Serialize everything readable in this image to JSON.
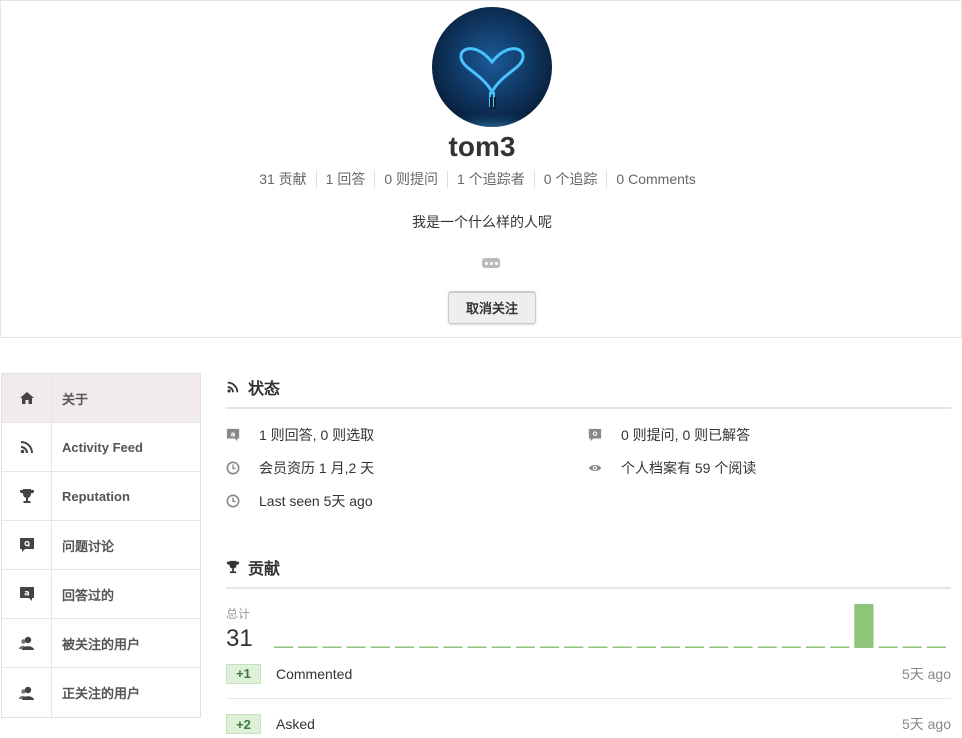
{
  "profile": {
    "username": "tom3",
    "stats": [
      "31 贡献",
      "1 回答",
      "0 则提问",
      "1 个追踪者",
      "0 个追踪",
      "0 Comments"
    ],
    "bio": "我是一个什么样的人呢",
    "unfollow_label": "取消关注",
    "colors": {
      "avatar_bg": "#0a2c55",
      "heart": "#2aa8ff"
    }
  },
  "sidebar": {
    "items": [
      {
        "label": "关于",
        "icon": "home-icon",
        "active": true
      },
      {
        "label": "Activity Feed",
        "icon": "rss-icon"
      },
      {
        "label": "Reputation",
        "icon": "trophy-icon"
      },
      {
        "label": "问题讨论",
        "icon": "question-bubble-icon"
      },
      {
        "label": "回答过的",
        "icon": "answer-bubble-icon"
      },
      {
        "label": "被关注的用户",
        "icon": "users-icon"
      },
      {
        "label": "正关注的用户",
        "icon": "users-icon"
      }
    ]
  },
  "status": {
    "title": "状态",
    "items": [
      {
        "text": "1 则回答, 0 则选取",
        "icon": "answer-bubble-icon"
      },
      {
        "text": "0 则提问, 0 则已解答",
        "icon": "question-bubble-icon"
      },
      {
        "text": "会员资历 1 月,2 天",
        "icon": "clock-icon"
      },
      {
        "text": "个人档案有 59 个阅读",
        "icon": "eye-icon"
      },
      {
        "text": "Last seen 5天 ago",
        "icon": "clock-icon"
      }
    ]
  },
  "contributions": {
    "title": "贡献",
    "total_label": "总计",
    "total_value": "31",
    "activities": [
      {
        "badge": "+1",
        "label": "Commented",
        "time": "5天 ago"
      },
      {
        "badge": "+2",
        "label": "Asked",
        "time": "5天 ago"
      }
    ]
  },
  "chart_data": {
    "type": "bar",
    "bar_count": 28,
    "values": [
      0,
      0,
      0,
      0,
      0,
      0,
      0,
      0,
      0,
      0,
      0,
      0,
      0,
      0,
      0,
      0,
      0,
      0,
      0,
      0,
      0,
      0,
      0,
      0,
      29,
      0,
      0,
      0
    ],
    "color": "#8dc57a",
    "title": "",
    "xlabel": "",
    "ylabel": ""
  }
}
